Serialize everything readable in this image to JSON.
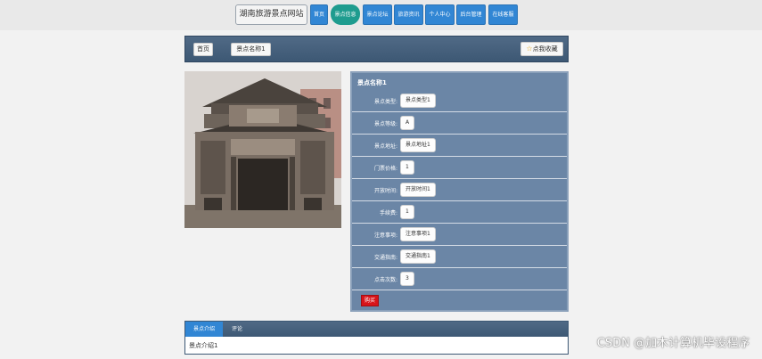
{
  "header": {
    "site_title": "湖南旅游景点网站",
    "nav": [
      {
        "label": "首页"
      },
      {
        "label": "景点信息",
        "active": true
      },
      {
        "label": "景点论坛"
      },
      {
        "label": "旅游资讯"
      },
      {
        "label": "个人中心"
      },
      {
        "label": "后台管理"
      },
      {
        "label": "在线客服"
      }
    ]
  },
  "breadcrumb": {
    "home": "首页",
    "current": "景点名称1",
    "favorite_label": "点我收藏",
    "favorite_icon": "star-icon"
  },
  "detail": {
    "title": "景点名称1",
    "fields": [
      {
        "label": "景点类型:",
        "value": "景点类型1"
      },
      {
        "label": "景点等级:",
        "value": "A"
      },
      {
        "label": "景点地址:",
        "value": "景点地址1"
      },
      {
        "label": "门票价格:",
        "value": "1"
      },
      {
        "label": "开放时间:",
        "value": "开放时间1"
      },
      {
        "label": "手续费:",
        "value": "1"
      },
      {
        "label": "注意事项:",
        "value": "注意事项1"
      },
      {
        "label": "交通指南:",
        "value": "交通指南1"
      },
      {
        "label": "点击次数:",
        "value": "3"
      }
    ],
    "buy_label": "购买"
  },
  "tabs": {
    "items": [
      {
        "label": "景点介绍",
        "active": true
      },
      {
        "label": "评论"
      }
    ],
    "content": "景点介绍1"
  },
  "watermark": "CSDN @加木计算机毕设程序",
  "colors": {
    "nav_blue": "#3186d4",
    "nav_active": "#1e9c8f",
    "panel_dark": "#3d5874",
    "detail_bg": "#6b86a6",
    "buy_red": "#d7141a"
  }
}
